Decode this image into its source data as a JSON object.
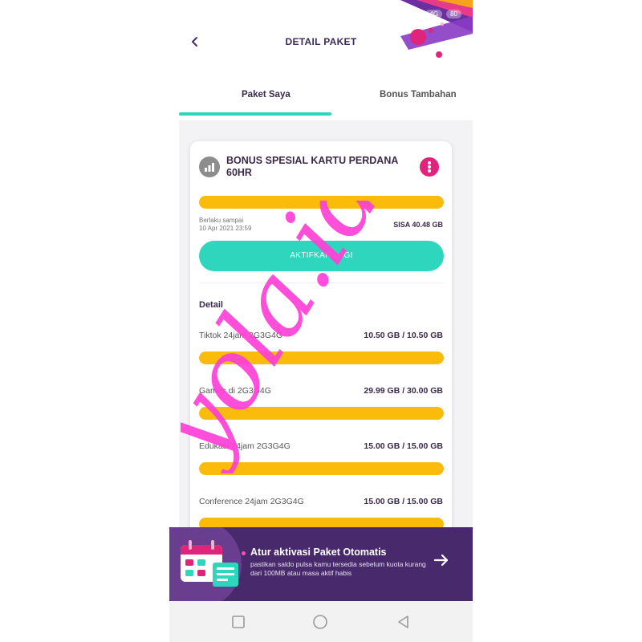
{
  "status_bar": {
    "indicator": "4G",
    "battery": "80"
  },
  "header": {
    "title": "DETAIL PAKET",
    "back_icon": "chevron-left-icon"
  },
  "tabs": [
    {
      "label": "Paket Saya",
      "active": true
    },
    {
      "label": "Bonus Tambahan",
      "active": false
    }
  ],
  "package": {
    "title": "BONUS SPESIAL KARTU PERDANA 60HR",
    "usage_fraction": 1.0,
    "valid_until_label": "Berlaku sampai",
    "valid_until_date": "10 Apr 2021 23:59",
    "remaining": "SISA 40.48 GB",
    "activate_label": "AKTIFKAN LAGI",
    "detail_heading": "Detail",
    "details": [
      {
        "label": "Tiktok 24jam 2G3G4G",
        "value": "10.50 GB / 10.50 GB",
        "fraction": 1.0
      },
      {
        "label": "Games di 2G3G4G",
        "value": "29.99 GB / 30.00 GB",
        "fraction": 0.9997
      },
      {
        "label": "Edukasi 24jam 2G3G4G",
        "value": "15.00 GB / 15.00 GB",
        "fraction": 1.0
      },
      {
        "label": "Conference 24jam 2G3G4G",
        "value": "15.00 GB / 15.00 GB",
        "fraction": 1.0
      }
    ]
  },
  "banner": {
    "title": "Atur aktivasi Paket Otomatis",
    "description": "pastikan saldo pulsa kamu tersedia sebelum kuota kurang dari 100MB atau masa aktif habis"
  },
  "watermark": {
    "text": "yola.id",
    "color": "#ff3fd6"
  },
  "colors": {
    "accent_teal": "#2dd6bc",
    "usage_yellow": "#fbbb0b",
    "menu_pink": "#e0247c",
    "banner_purple": "#482a6c",
    "title_dark": "#3a2a4a"
  }
}
